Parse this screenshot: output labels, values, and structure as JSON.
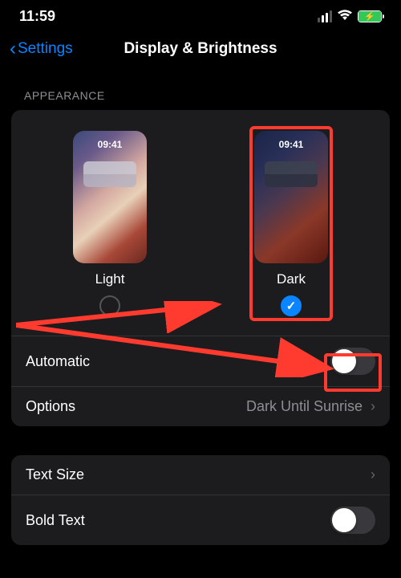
{
  "status": {
    "time": "11:59",
    "battery_icon": "bolt"
  },
  "nav": {
    "back_label": "Settings",
    "title": "Display & Brightness"
  },
  "appearance": {
    "header": "APPEARANCE",
    "preview_time": "09:41",
    "light_label": "Light",
    "dark_label": "Dark"
  },
  "rows": {
    "automatic_label": "Automatic",
    "options_label": "Options",
    "options_value": "Dark Until Sunrise",
    "text_size_label": "Text Size",
    "bold_text_label": "Bold Text"
  }
}
